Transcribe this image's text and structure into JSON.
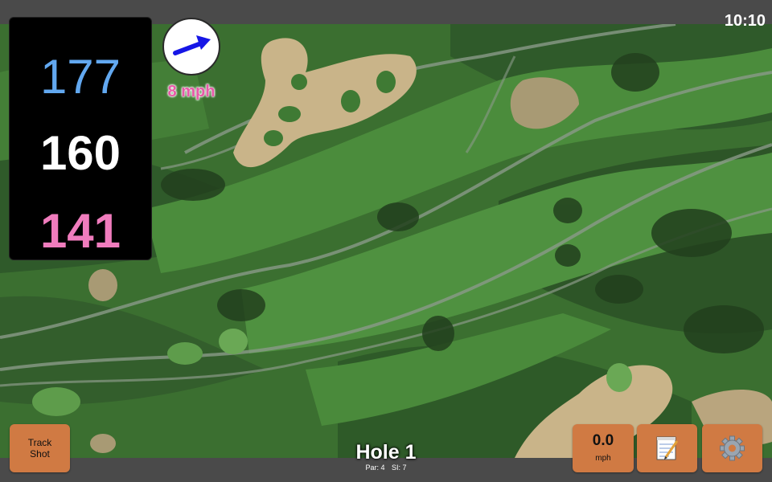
{
  "status_bar": {
    "time": "10:10"
  },
  "distances": {
    "back": "177",
    "middle": "160",
    "front": "141"
  },
  "distance_colors": {
    "back": "#62a8f0",
    "middle": "#ffffff",
    "front": "#f07cbd"
  },
  "wind": {
    "speed_label": "8 mph",
    "arrow_icon": "arrow-right-up-icon",
    "arrow_color": "#1616e6"
  },
  "hole": {
    "title": "Hole 1",
    "par_label": "Par: 4",
    "si_label": "SI: 7"
  },
  "buttons": {
    "track_shot_line1": "Track",
    "track_shot_line2": "Shot",
    "speed_value": "0.0",
    "speed_unit": "mph",
    "notes_icon": "notepad-icon",
    "settings_icon": "gear-icon"
  },
  "colors": {
    "button": "#d07a43",
    "bar": "#4a4a4a"
  }
}
